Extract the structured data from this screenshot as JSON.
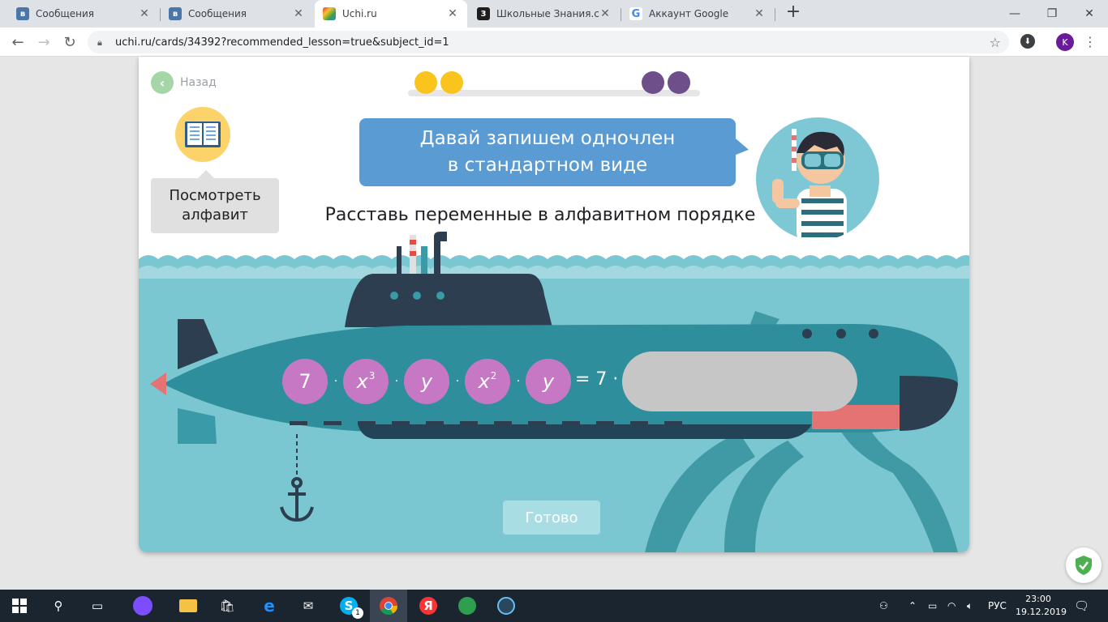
{
  "browser": {
    "tabs": [
      {
        "title": "Сообщения",
        "active": false,
        "icon": "vk-icon"
      },
      {
        "title": "Сообщения",
        "active": false,
        "icon": "vk-icon"
      },
      {
        "title": "Uchi.ru",
        "active": true,
        "icon": "uchi-icon"
      },
      {
        "title": "Школьные Знания.com",
        "active": false,
        "icon": "znanija-icon"
      },
      {
        "title": "Аккаунт Google",
        "active": false,
        "icon": "google-icon"
      }
    ],
    "url": "uchi.ru/cards/34392?recommended_lesson=true&subject_id=1",
    "profile_initial": "K"
  },
  "lesson": {
    "back_label": "Назад",
    "progress": {
      "completed": 2,
      "remaining": 2,
      "completed_color": "#f9c51d",
      "remaining_color": "#6e4f8a"
    },
    "alphabet_button": "Посмотреть\nалфавит",
    "bubble_text": "Давай запишем одночлен\nв стандартном виде",
    "instruction": "Расставь переменные в алфавитном порядке",
    "expression": {
      "terms": [
        {
          "base": "7",
          "exp": ""
        },
        {
          "base": "x",
          "exp": "3"
        },
        {
          "base": "y",
          "exp": ""
        },
        {
          "base": "x",
          "exp": "2"
        },
        {
          "base": "y",
          "exp": ""
        }
      ],
      "dot": "·",
      "result": "= 7 ·"
    },
    "done_button": "Готово",
    "colors": {
      "term": "#c778c4",
      "sea": "#7ac6d1",
      "bubble": "#5a9bd4"
    }
  },
  "taskbar": {
    "lang": "РУС",
    "time": "23:00",
    "date": "19.12.2019",
    "skype_badge": "1"
  }
}
